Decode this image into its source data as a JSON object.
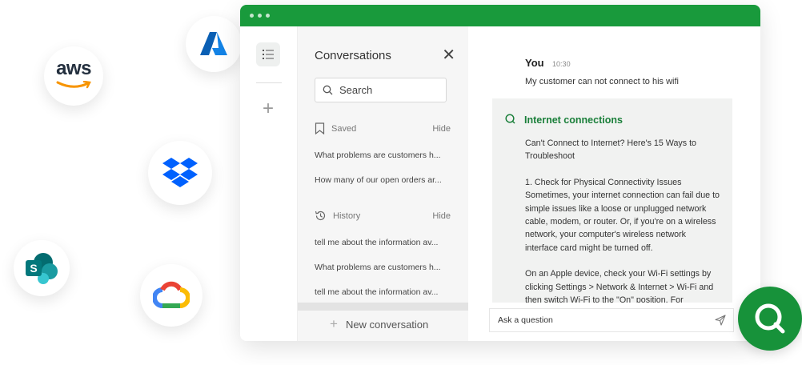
{
  "integrations": [
    {
      "name": "aws",
      "label": "aws"
    },
    {
      "name": "azure",
      "label": ""
    },
    {
      "name": "dropbox",
      "label": ""
    },
    {
      "name": "sharepoint",
      "label": ""
    },
    {
      "name": "google-cloud",
      "label": ""
    }
  ],
  "colors": {
    "brand_green": "#199a3c",
    "answer_title": "#1a7f3a"
  },
  "rail": {
    "icons": [
      "list-icon",
      "plus-icon"
    ]
  },
  "conversations": {
    "title": "Conversations",
    "close_icon": "close-icon",
    "search": {
      "placeholder": "Search",
      "value": ""
    },
    "saved": {
      "label": "Saved",
      "hide": "Hide",
      "items": [
        "What problems are customers h...",
        "How many of our open orders ar..."
      ]
    },
    "history": {
      "label": "History",
      "hide": "Hide",
      "items": [
        "tell me about the information av...",
        "What problems are customers h...",
        "tell me about the information av..."
      ]
    },
    "new_conversation": "New conversation"
  },
  "chat": {
    "user": {
      "name": "You",
      "time": "10:30",
      "text": "My customer can not connect to his wifi"
    },
    "answer": {
      "title": "Internet connections",
      "paragraphs": [
        "Can't Connect to Internet? Here's 15 Ways to Troubleshoot",
        "1. Check for Physical Connectivity Issues Sometimes, your internet connection can fail due to simple issues like a loose or unplugged network cable, modem, or router. Or, if you're on a wireless network, your computer's wireless network interface card might be turned off.",
        "On an Apple device, check your Wi-Fi settings by clicking Settings > Network & Internet > Wi-Fi and then switch Wi-Fi to the \"On\" position. For"
      ]
    },
    "input": {
      "placeholder": "Ask a question",
      "value": ""
    }
  }
}
